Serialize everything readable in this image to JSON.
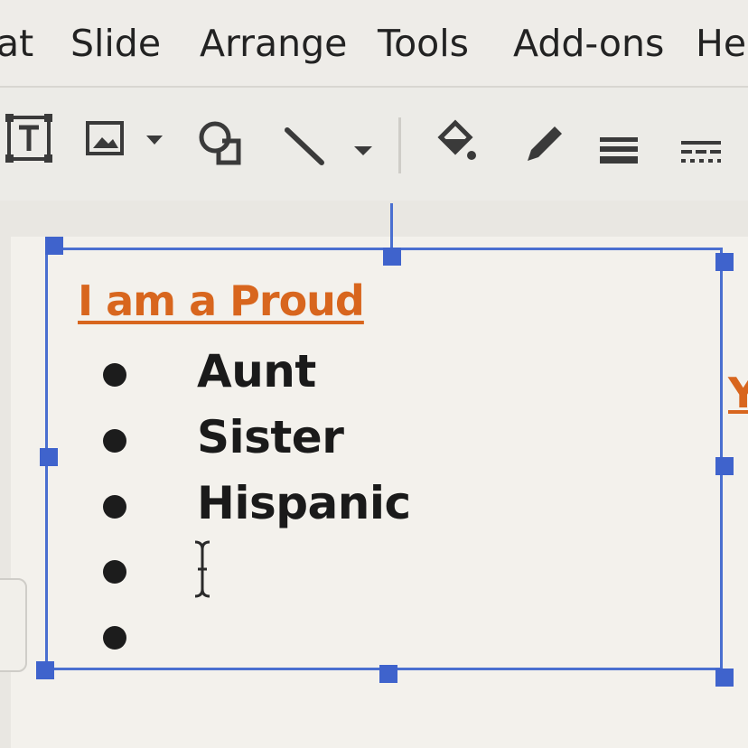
{
  "menu": {
    "items": [
      "at",
      "Slide",
      "Arrange",
      "Tools",
      "Add-ons",
      "He"
    ]
  },
  "toolbar": {
    "icons": [
      "text-box-icon",
      "image-icon",
      "dropdown-arrow-icon",
      "shape-icon",
      "line-icon",
      "dropdown-arrow-icon",
      "fill-color-icon",
      "border-color-icon",
      "border-weight-icon",
      "border-dash-icon"
    ]
  },
  "textbox": {
    "title": "I am a Proud",
    "items": [
      "Aunt",
      "Sister",
      "Hispanic",
      "",
      ""
    ]
  },
  "offscreen_text": "Y",
  "colors": {
    "title": "#d8661e",
    "selection": "#4a6fd0",
    "text": "#1a1a1a"
  }
}
